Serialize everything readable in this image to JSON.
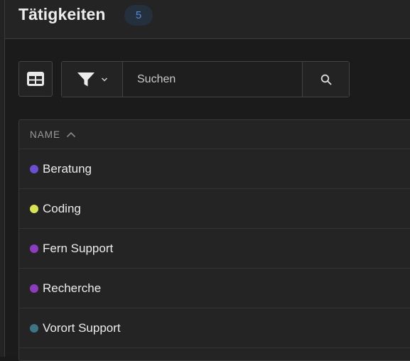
{
  "header": {
    "title": "Tätigkeiten",
    "count": "5"
  },
  "toolbar": {
    "view_toggle_icon": "table-view-icon",
    "filter_icon": "filter-icon",
    "filter_chevron_icon": "chevron-down-icon",
    "search_placeholder": "Suchen",
    "search_value": "",
    "search_icon": "search-icon"
  },
  "table": {
    "columns": [
      {
        "label": "NAME",
        "sort": "ascending",
        "sort_icon": "chevron-up-icon"
      }
    ],
    "rows": [
      {
        "name": "Beratung",
        "color": "#6a4fd0"
      },
      {
        "name": "Coding",
        "color": "#d6e352"
      },
      {
        "name": "Fern Support",
        "color": "#8e3cbf"
      },
      {
        "name": "Recherche",
        "color": "#8e3cbf"
      },
      {
        "name": "Vorort Support",
        "color": "#3e7484"
      }
    ]
  },
  "colors": {
    "background": "#1b1b1b",
    "surface": "#242424",
    "badge_bg": "#25303e",
    "badge_text": "#5a8ad6"
  }
}
